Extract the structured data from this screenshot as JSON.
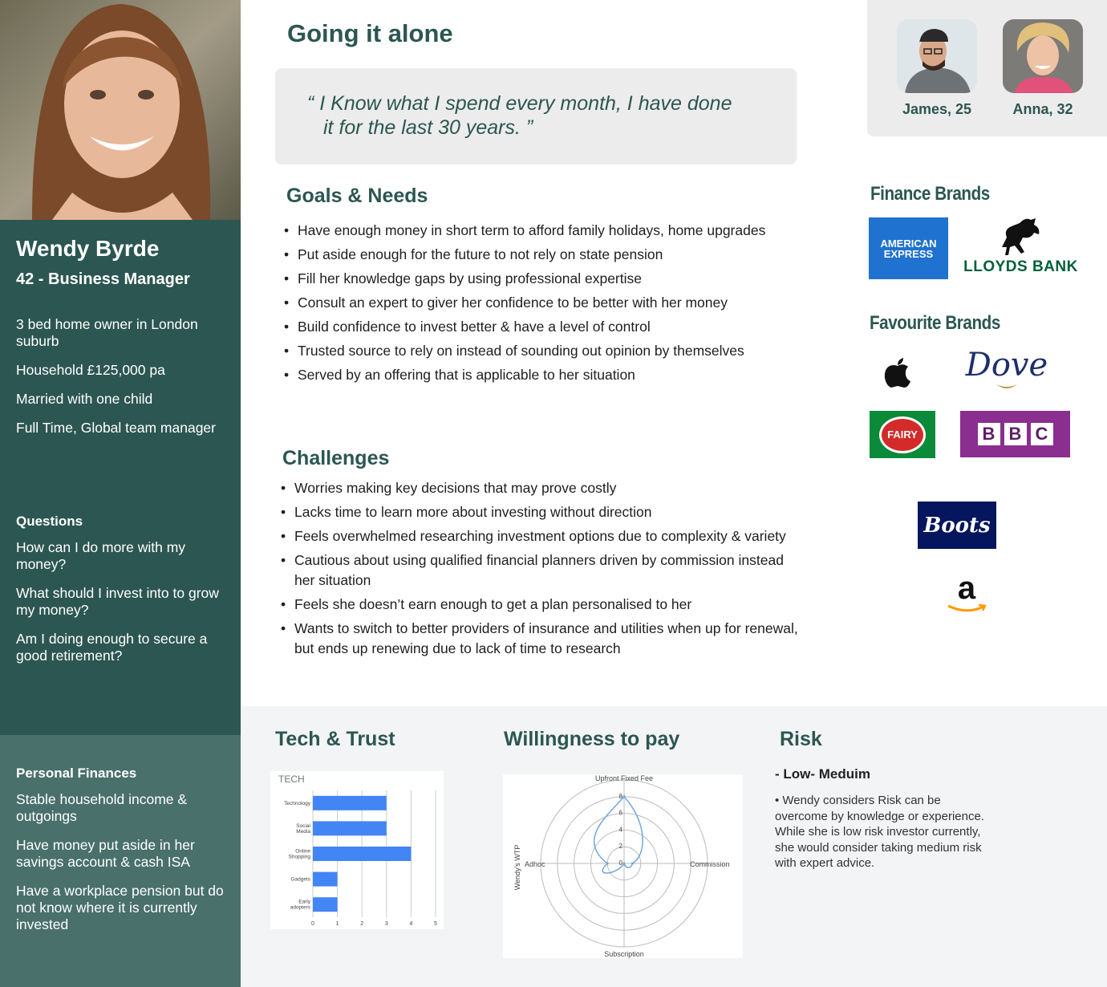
{
  "persona": {
    "name": "Wendy Byrde",
    "role": "42 - Business Manager",
    "facts": [
      "3 bed home owner in London suburb",
      "Household £125,000 pa",
      "Married with one child",
      "Full Time, Global team manager"
    ],
    "questions_title": "Questions",
    "questions": [
      "How can I do more with my money?",
      "What should I invest into to grow my money?",
      "Am I doing enough to secure a good retirement?"
    ],
    "finances_title": "Personal Finances",
    "finances": [
      "Stable household income & outgoings",
      "Have money put aside in her savings account & cash ISA",
      "Have a workplace pension but do not know where it is currently invested"
    ]
  },
  "main": {
    "title": "Going it alone",
    "quote_line1": "“ I Know what I spend every month, I have done",
    "quote_line2": "it for the last 30 years. ”",
    "goals_title": "Goals & Needs",
    "goals": [
      "Have enough money in short term to afford family holidays, home upgrades",
      "Put aside enough for the future to not rely on state pension",
      "Fill her knowledge gaps by using professional expertise",
      "Consult an expert to giver her confidence to be better with her money",
      "Build confidence to invest better & have a level of control",
      "Trusted source  to rely on instead of sounding out opinion by themselves",
      "Served by an offering that is applicable to her situation"
    ],
    "challenges_title": "Challenges",
    "challenges": [
      "Worries making key decisions that may prove costly",
      "Lacks time to learn more about investing without direction",
      "Feels overwhelmed researching investment options due to complexity & variety",
      "Cautious about using qualified financial planners driven by commission instead her situation",
      "Feels she doesn’t earn enough to get a plan personalised to her",
      "Wants to switch to better providers of insurance and utilities when up for renewal, but ends up renewing due to lack of time to research"
    ]
  },
  "related_personas": [
    {
      "label": "James, 25"
    },
    {
      "label": "Anna, 32"
    }
  ],
  "brands": {
    "finance_title": "Finance Brands",
    "amex_line1": "AMERICAN",
    "amex_line2": "EXPRESS",
    "lloyds": "LLOYDS BANK",
    "favourite_title": "Favourite Brands",
    "dove": "Dove",
    "fairy": "FAIRY",
    "bbc": [
      "B",
      "B",
      "C"
    ],
    "boots": "Boots",
    "amazon": "a",
    "colors": {
      "amex": "#1f72cf",
      "lloyds": "#00603a",
      "fairy": "#0b8a3a",
      "bbc": "#8a2e8f",
      "boots": "#05155e",
      "dove": "#1d2f6b"
    }
  },
  "tech": {
    "title": "Tech & Trust",
    "chart_data": {
      "type": "bar",
      "orientation": "horizontal",
      "title": "TECH",
      "categories": [
        [
          "Technology"
        ],
        [
          "Social",
          "Media"
        ],
        [
          "Online",
          "Shopping"
        ],
        [
          "Gadgets"
        ],
        [
          "Early",
          "adopters"
        ]
      ],
      "values": [
        3,
        3,
        4,
        1,
        1
      ],
      "xlim": [
        0,
        5
      ],
      "xticks": [
        "0",
        "1",
        "2",
        "3",
        "4",
        "5"
      ],
      "color": "#4285f4"
    }
  },
  "wtp": {
    "title": "Willingness to pay",
    "chart_data": {
      "type": "radar",
      "axes": [
        "Upfront Fixed Fee",
        "Commission",
        "Subscription",
        "Adhoc"
      ],
      "values": [
        8,
        1,
        0,
        2
      ],
      "rticks": [
        "0",
        "2",
        "4",
        "6",
        "8"
      ],
      "rmax": 10,
      "ylabel": "Wendy's WTP",
      "color": "#6fa8dc"
    }
  },
  "risk": {
    "title": "Risk",
    "level": "- Low- Meduim",
    "text": "• Wendy considers Risk can be overcome by knowledge or experience. While she is low risk investor currently, she would consider taking medium  risk with expert advice."
  }
}
